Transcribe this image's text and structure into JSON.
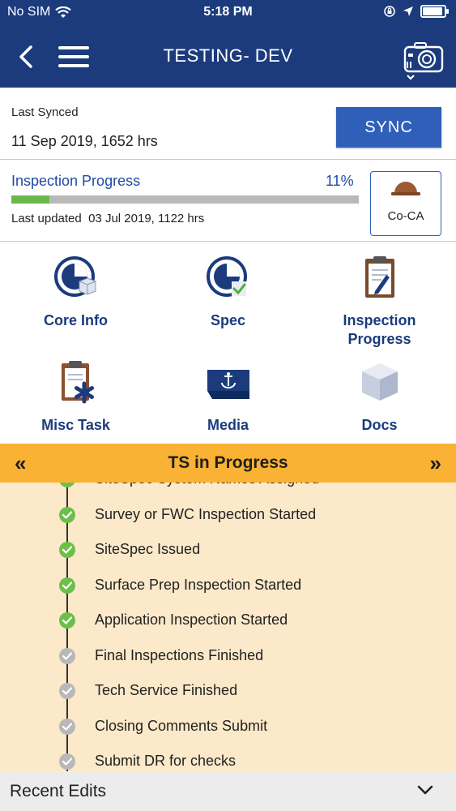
{
  "status_bar": {
    "carrier": "No SIM",
    "time": "5:18 PM"
  },
  "header": {
    "title": "TESTING- DEV"
  },
  "sync": {
    "label": "Last Synced",
    "date": "11 Sep 2019, 1652 hrs",
    "button": "SYNC"
  },
  "progress": {
    "title": "Inspection Progress",
    "percent_label": "11%",
    "percent": 11,
    "updated_label": "Last updated",
    "updated_value": "03 Jul 2019, 1122 hrs",
    "badge_label": "Co-CA",
    "fill_color": "#6bb84a"
  },
  "tiles": [
    {
      "label": "Core Info",
      "icon": "pie-chart-cube-icon"
    },
    {
      "label": "Spec",
      "icon": "pie-chart-check-icon"
    },
    {
      "label": "Inspection Progress",
      "icon": "clipboard-pen-icon"
    },
    {
      "label": "Misc Task",
      "icon": "clipboard-asterisk-icon"
    },
    {
      "label": "Media",
      "icon": "ship-anchor-icon"
    },
    {
      "label": "Docs",
      "icon": "cube-icon"
    }
  ],
  "banner": {
    "title": "TS in Progress",
    "prev": "«",
    "next": "»",
    "color": "#f9b233"
  },
  "steps": [
    {
      "label": "SiteSpec System Names Assigned",
      "done": true
    },
    {
      "label": "Survey or FWC Inspection Started",
      "done": true
    },
    {
      "label": "SiteSpec Issued",
      "done": true
    },
    {
      "label": "Surface Prep Inspection Started",
      "done": true
    },
    {
      "label": "Application Inspection Started",
      "done": true
    },
    {
      "label": "Final Inspections Finished",
      "done": false
    },
    {
      "label": "Tech Service Finished",
      "done": false
    },
    {
      "label": "Closing Comments Submit",
      "done": false
    },
    {
      "label": "Submit DR for checks",
      "done": false
    }
  ],
  "recent": {
    "label": "Recent Edits"
  },
  "colors": {
    "brand": "#1b3b7d",
    "accent": "#2f5fb8",
    "done": "#6cc04a",
    "pending": "#b8b8b8"
  }
}
